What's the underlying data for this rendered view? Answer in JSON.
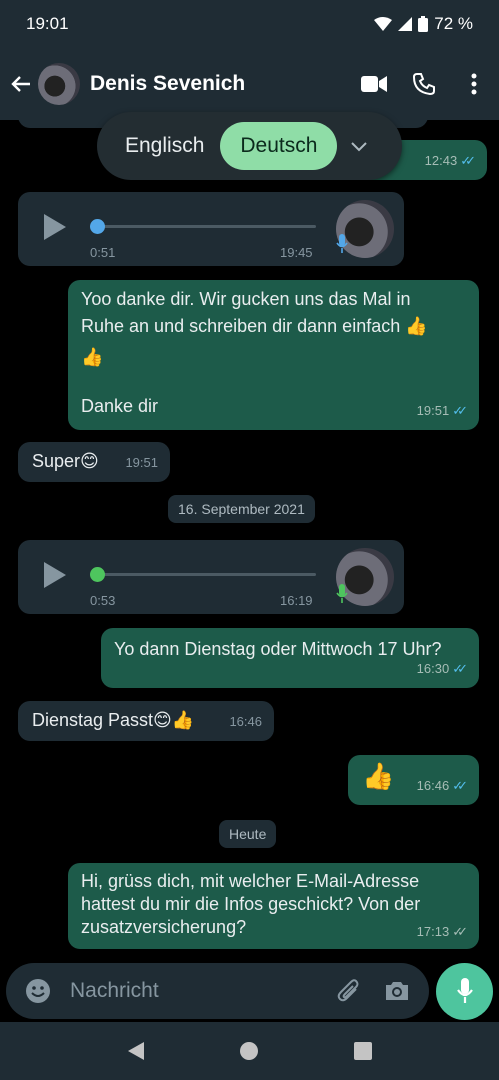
{
  "status_bar": {
    "time": "19:01",
    "battery": "72 %"
  },
  "header": {
    "contact_name": "Denis Sevenich"
  },
  "translate": {
    "source_lang": "Englisch",
    "target_lang": "Deutsch"
  },
  "messages": {
    "m1_time": "12:43",
    "v1": {
      "elapsed": "0:51",
      "time": "19:45"
    },
    "m2": {
      "line1": "Yoo danke dir. Wir gucken uns das Mal in",
      "line2": "Ruhe an und schreiben dir dann einfach 👍",
      "line3": "👍",
      "line4": "Danke dir",
      "time": "19:51"
    },
    "m3": {
      "text": "Super😊",
      "time": "19:51"
    },
    "date1": "16. September 2021",
    "v2": {
      "elapsed": "0:53",
      "time": "16:19"
    },
    "m4": {
      "text": "Yo dann Dienstag oder Mittwoch 17 Uhr?",
      "time": "16:30"
    },
    "m5": {
      "text": "Dienstag Passt😊👍",
      "time": "16:46"
    },
    "m6": {
      "text": "👍",
      "time": "16:46"
    },
    "date2": "Heute",
    "m7": {
      "line1": "Hi, grüss dich, mit welcher E-Mail-Adresse",
      "line2": "hattest du mir die Infos geschickt? Von der",
      "line3": "zusatzversicherung?",
      "time": "17:13"
    }
  },
  "composer": {
    "placeholder": "Nachricht"
  },
  "colors": {
    "outgoing": "#1d5b4a",
    "incoming": "#1f2c34",
    "accent": "#4ec59e",
    "read_tick": "#53bdeb"
  }
}
